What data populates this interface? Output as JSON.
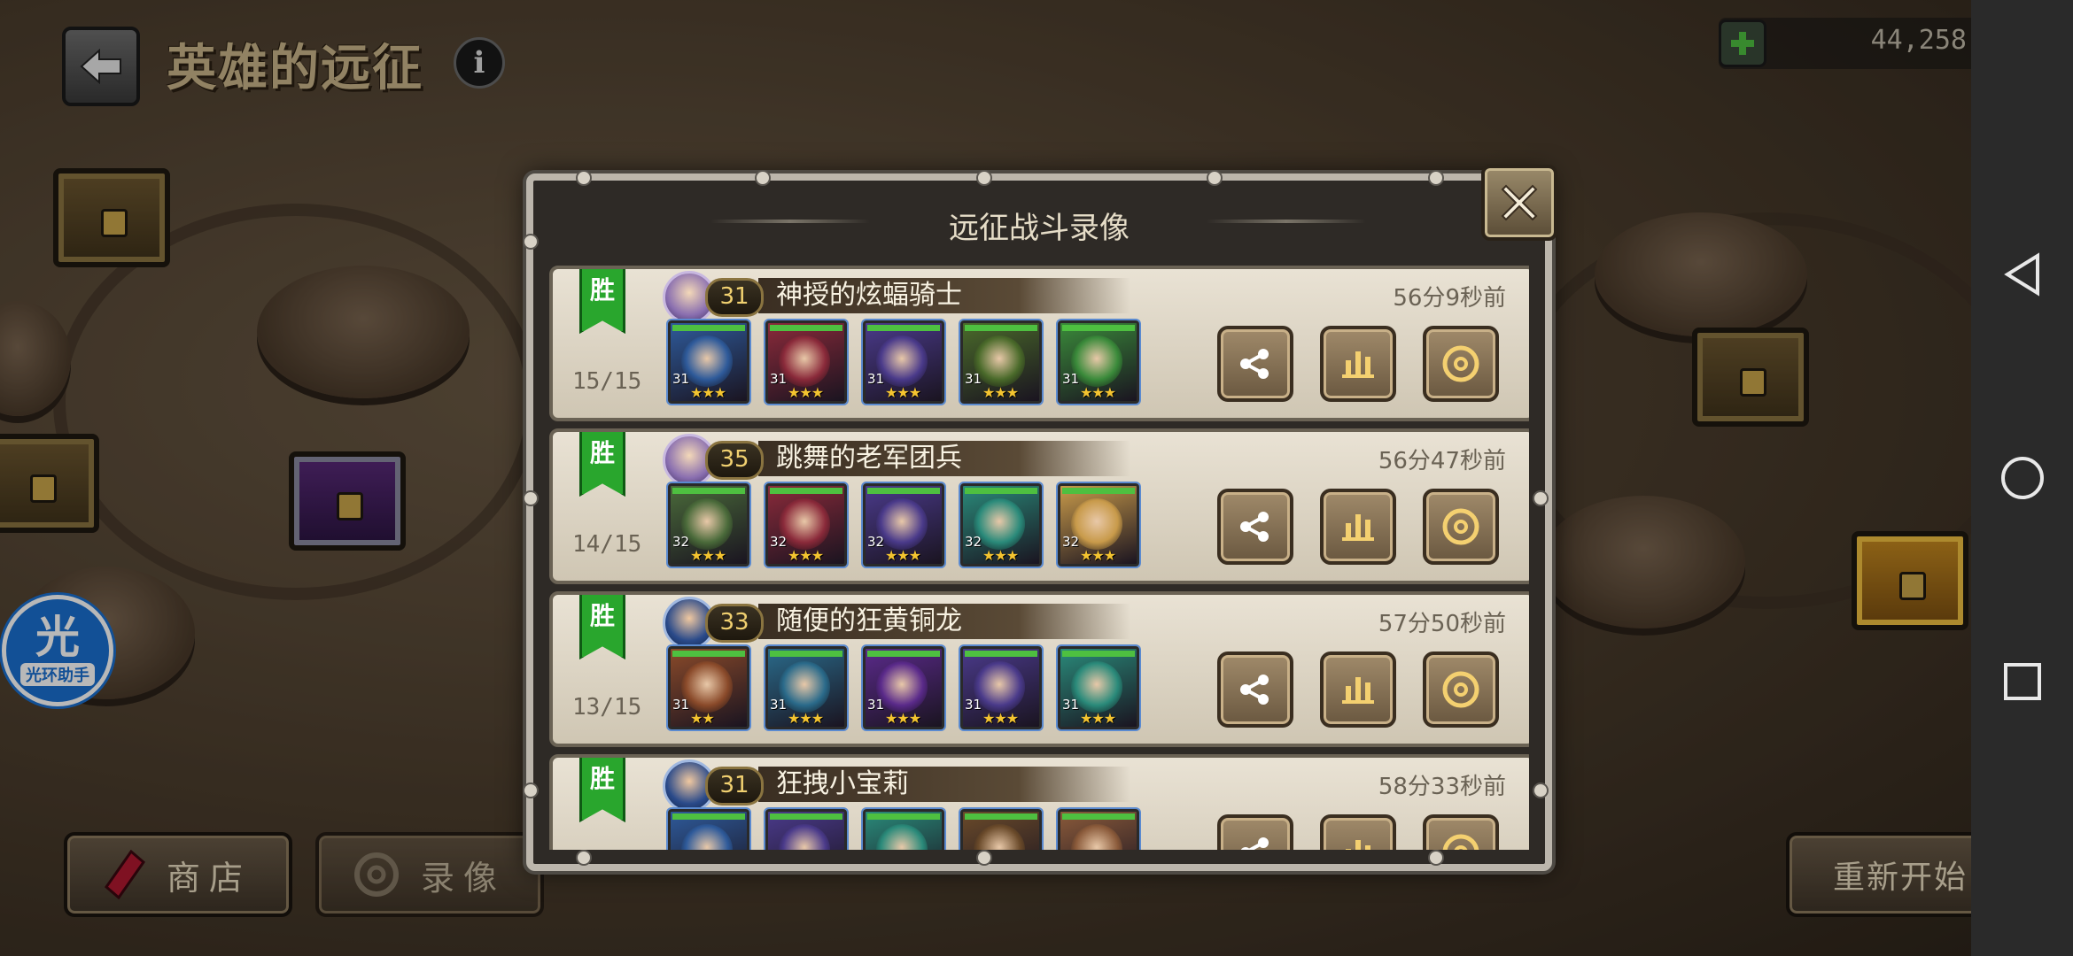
{
  "header": {
    "title": "英雄的远征",
    "info_icon": "i",
    "gold_amount": "44,258"
  },
  "helper": {
    "big": "光",
    "label": "光环助手"
  },
  "bottom": {
    "shop_label": "商店",
    "replay_label": "录像",
    "restart_label": "重新开始"
  },
  "modal": {
    "title": "远征战斗录像",
    "records": [
      {
        "result": "胜",
        "progress": "15/15",
        "level": "31",
        "name": "神授的炫蝠骑士",
        "time_ago": "56分9秒前",
        "heroes": [
          {
            "level": "31",
            "stars": "★★★",
            "color": "#2e5a9a"
          },
          {
            "level": "31",
            "stars": "★★★",
            "color": "#8a2a3a"
          },
          {
            "level": "31",
            "stars": "★★★",
            "color": "#4a3a8a"
          },
          {
            "level": "31",
            "stars": "★★★",
            "color": "#4a6a2a"
          },
          {
            "level": "31",
            "stars": "★★★",
            "color": "#3a8a3a"
          }
        ]
      },
      {
        "result": "胜",
        "progress": "14/15",
        "level": "35",
        "name": "跳舞的老军团兵",
        "time_ago": "56分47秒前",
        "heroes": [
          {
            "level": "32",
            "stars": "★★★",
            "color": "#4a6a3a"
          },
          {
            "level": "32",
            "stars": "★★★",
            "color": "#8a2a3a"
          },
          {
            "level": "32",
            "stars": "★★★",
            "color": "#4a3a8a"
          },
          {
            "level": "32",
            "stars": "★★★",
            "color": "#2a8a7a"
          },
          {
            "level": "32",
            "stars": "★★★",
            "color": "#c89a4a"
          }
        ]
      },
      {
        "result": "胜",
        "progress": "13/15",
        "level": "33",
        "name": "随便的狂黄铜龙",
        "time_ago": "57分50秒前",
        "heroes": [
          {
            "level": "31",
            "stars": "★★",
            "color": "#8a4a2a"
          },
          {
            "level": "31",
            "stars": "★★★",
            "color": "#2a6a8a"
          },
          {
            "level": "31",
            "stars": "★★★",
            "color": "#5a2a8a"
          },
          {
            "level": "31",
            "stars": "★★★",
            "color": "#4a3a8a"
          },
          {
            "level": "31",
            "stars": "★★★",
            "color": "#2a8a7a"
          }
        ]
      },
      {
        "result": "胜",
        "progress": "",
        "level": "31",
        "name": "狂拽小宝莉",
        "time_ago": "58分33秒前",
        "heroes": [
          {
            "level": "",
            "stars": "",
            "color": "#2e5a9a"
          },
          {
            "level": "",
            "stars": "",
            "color": "#4a3a8a"
          },
          {
            "level": "",
            "stars": "",
            "color": "#2a8a7a"
          },
          {
            "level": "",
            "stars": "",
            "color": "#6a4a2a"
          },
          {
            "level": "",
            "stars": "",
            "color": "#8a5a3a"
          }
        ]
      }
    ]
  },
  "icons": {
    "back": "back-arrow-icon",
    "add_gold": "plus-icon",
    "coin": "gold-coin-icon",
    "close": "close-icon",
    "share": "share-icon",
    "stats": "bar-chart-icon",
    "replay": "replay-icon",
    "shop": "red-crystal-icon",
    "nav_back": "triangle-back-icon",
    "nav_home": "circle-home-icon",
    "nav_recent": "square-recent-icon"
  }
}
